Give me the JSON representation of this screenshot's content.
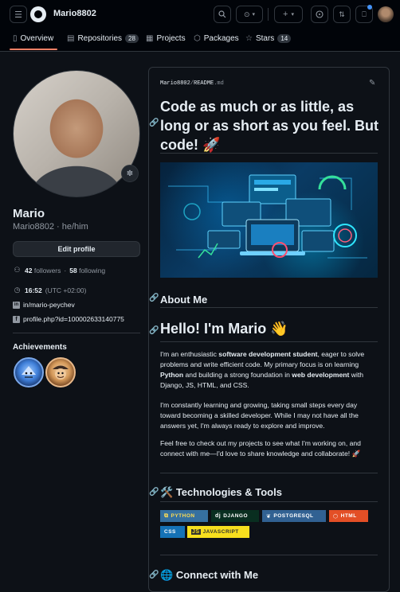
{
  "header": {
    "owner": "Mario8802"
  },
  "tabs": [
    {
      "label": "Overview",
      "icon": "book-icon"
    },
    {
      "label": "Repositories",
      "icon": "repo-icon",
      "count": "28"
    },
    {
      "label": "Projects",
      "icon": "table-icon"
    },
    {
      "label": "Packages",
      "icon": "package-icon"
    },
    {
      "label": "Stars",
      "icon": "star-icon",
      "count": "14"
    }
  ],
  "profile": {
    "name": "Mario",
    "login": "Mario8802",
    "separator": " · ",
    "pronouns": "he/him",
    "edit_label": "Edit profile",
    "followers_count": "42",
    "followers_label": "followers",
    "dot": "·",
    "following_count": "58",
    "following_label": "following",
    "time": "16:52",
    "timezone": "(UTC +02:00)",
    "linkedin": "in/mario-peychev",
    "facebook": "profile.php?id=100002633140775"
  },
  "achievements": {
    "title": "Achievements"
  },
  "readme": {
    "owner": "Mario8802",
    "sep": "/",
    "file_name": "README",
    "file_ext": ".md",
    "title": "Code as much or as little, as long or as short as you feel. But code!",
    "title_emoji": "🚀",
    "about_heading": "About Me",
    "hello_heading": "Hello! I'm Mario",
    "hello_emoji": "👋",
    "p1_a": "I'm an enthusiastic ",
    "p1_b": "software development student",
    "p1_c": ", eager to solve problems and write efficient code. My primary focus is on learning ",
    "p1_d": "Python",
    "p1_e": " and building a strong foundation in ",
    "p1_f": "web development",
    "p1_g": " with Django, JS, HTML, and CSS.",
    "p2": "I'm constantly learning and growing, taking small steps every day toward becoming a skilled developer. While I may not have all the answers yet, I'm always ready to explore and improve.",
    "p3": "Feel free to check out my projects to see what I'm working on, and connect with me—I'd love to share knowledge and collaborate! 🚀",
    "tech_emoji": "🛠️",
    "tech_heading": "Technologies & Tools",
    "connect_emoji": "🌐",
    "connect_heading": "Connect with Me",
    "badges": [
      {
        "label": "PYTHON",
        "bg": "#3670A0",
        "fg": "#ffdd54",
        "icon": "python-icon"
      },
      {
        "label": "DJANGO",
        "bg": "#092E20",
        "fg": "#ffffff",
        "icon": "django-icon"
      },
      {
        "label": "POSTGRESQL",
        "bg": "#316192",
        "fg": "#ffffff",
        "icon": "postgresql-icon"
      },
      {
        "label": "HTML",
        "bg": "#E34F26",
        "fg": "#ffffff",
        "icon": "html5-icon"
      },
      {
        "label": "CSS",
        "bg": "#1572B6",
        "fg": "#ffffff",
        "icon": "css3-icon"
      },
      {
        "label": "JAVASCRIPT",
        "bg": "#F7DF1E",
        "fg": "#323330",
        "icon": "javascript-icon"
      }
    ]
  },
  "colors": {
    "accent": "#f78166",
    "link": "#4493f8",
    "background": "#0d1117",
    "border": "#30363d"
  }
}
